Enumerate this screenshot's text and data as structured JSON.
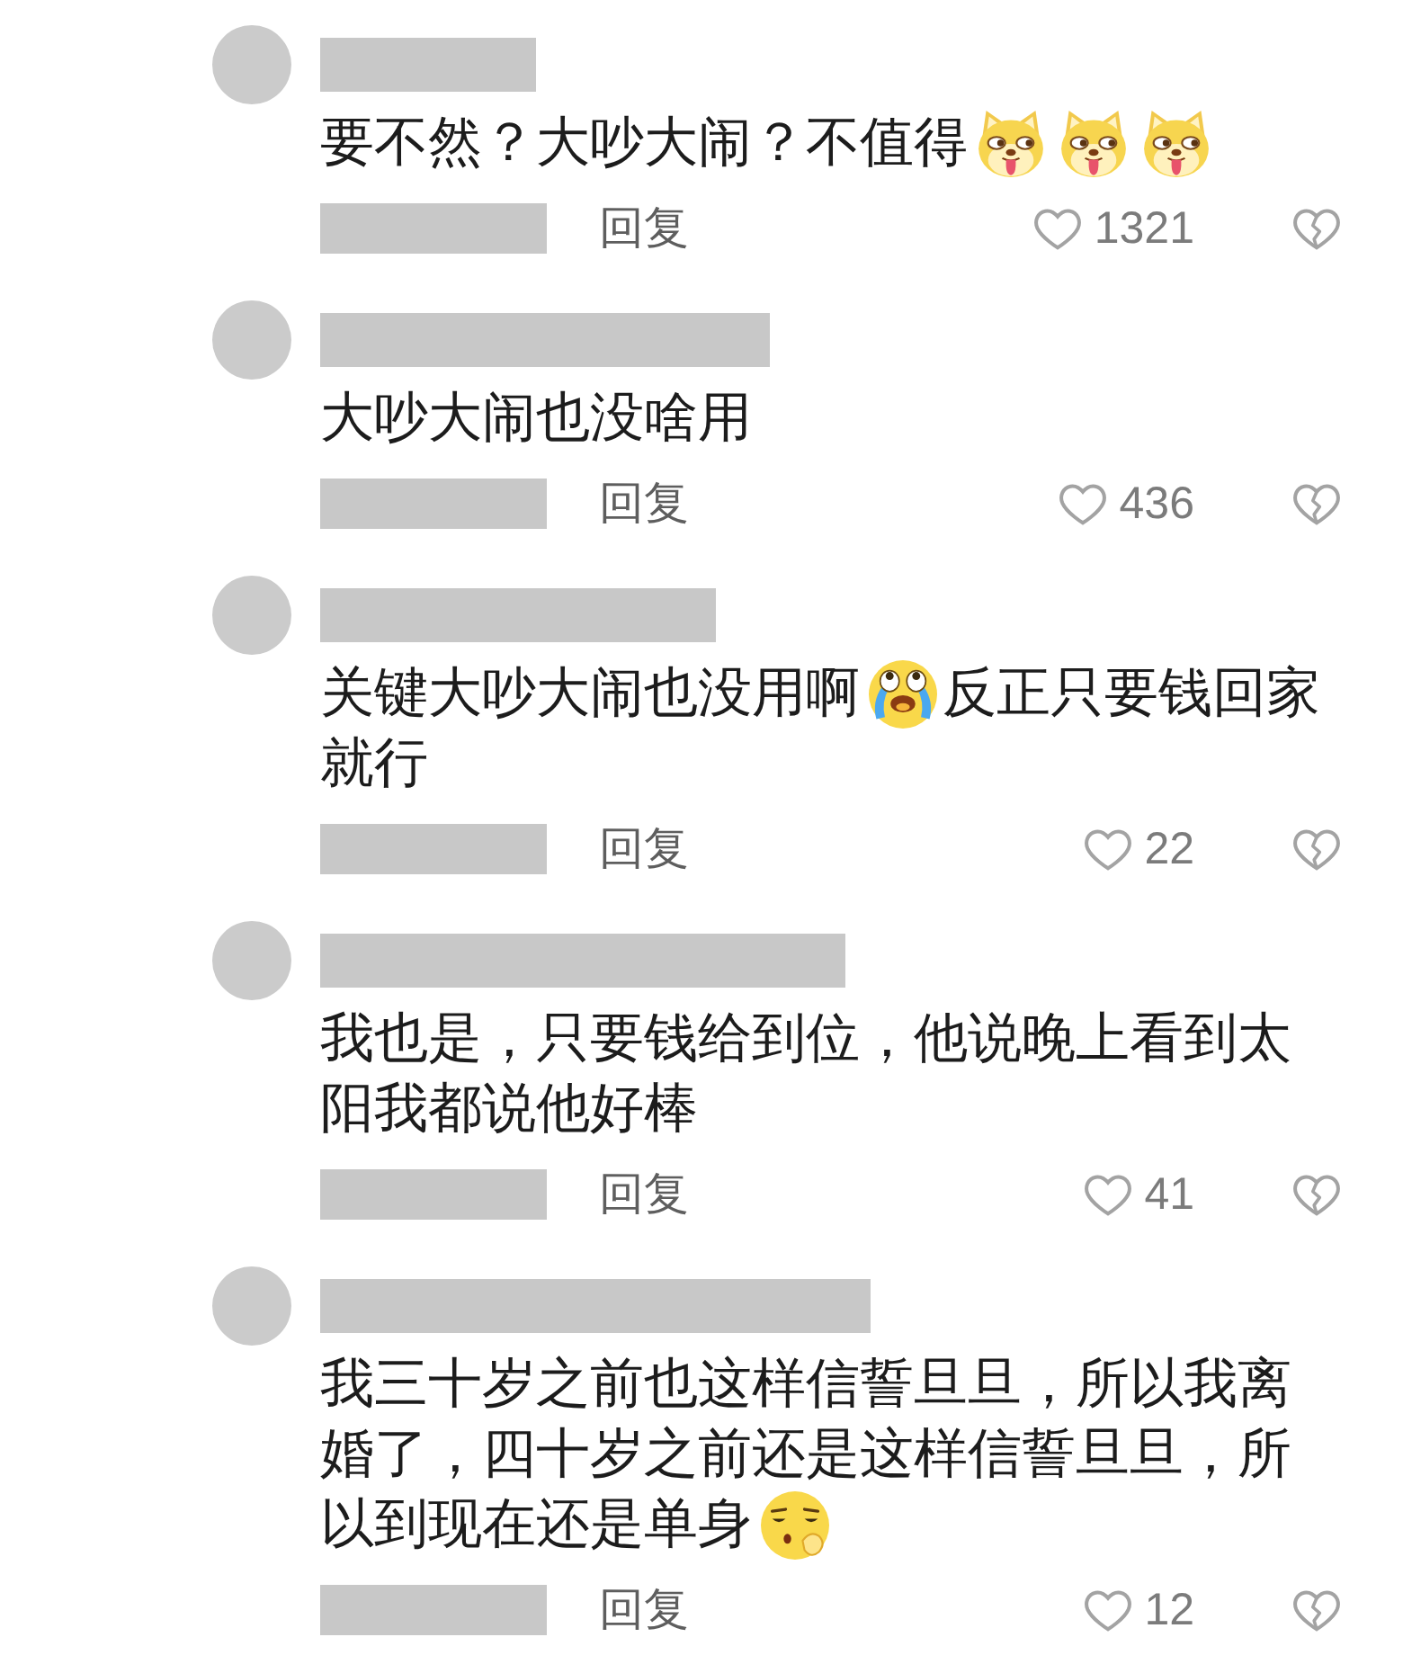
{
  "comments": [
    {
      "body": [
        {
          "kind": "text",
          "text": "要不然？大吵大闹？不值得"
        },
        {
          "kind": "dog"
        },
        {
          "kind": "dog"
        },
        {
          "kind": "dog"
        }
      ],
      "reply": "回复",
      "likes": "1321"
    },
    {
      "body": [
        {
          "kind": "text",
          "text": "大吵大闹也没啥用"
        }
      ],
      "reply": "回复",
      "likes": "436"
    },
    {
      "body": [
        {
          "kind": "text",
          "text": "关键大吵大闹也没用啊"
        },
        {
          "kind": "teary"
        },
        {
          "kind": "text",
          "text": "反正只要钱回家就行"
        }
      ],
      "reply": "回复",
      "likes": "22"
    },
    {
      "body": [
        {
          "kind": "text",
          "text": "我也是，只要钱给到位，他说晚上看到太阳我都说他好棒"
        }
      ],
      "reply": "回复",
      "likes": "41"
    },
    {
      "body": [
        {
          "kind": "text",
          "text": "我三十岁之前也这样信誓旦旦，所以我离婚了，四十岁之前还是这样信誓旦旦，所以到现在还是单身"
        },
        {
          "kind": "pondering"
        }
      ],
      "reply": "回复",
      "likes": "12"
    }
  ]
}
